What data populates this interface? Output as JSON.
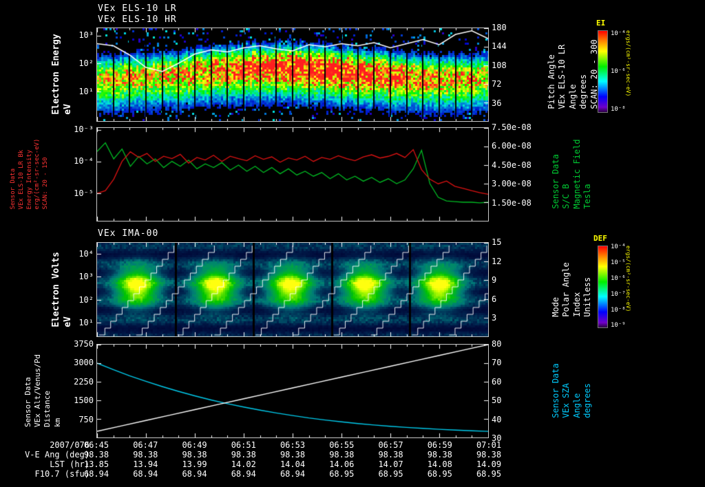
{
  "page": {
    "background": "#000000",
    "accent_yellow": "#ffff00",
    "accent_red": "#ff3333",
    "accent_green": "#00cc33",
    "accent_cyan": "#00ccff"
  },
  "panels": {
    "p1": {
      "titles": [
        "VEx ELS-10 LR",
        "VEx ELS-10 HR"
      ],
      "left_label": [
        "Electron Energy",
        "eV"
      ],
      "right_label": [
        "Pitch Angle",
        "VEx ELS-10 LR",
        "Angle",
        "degrees",
        "SCAN: 20 - 300"
      ]
    },
    "p2": {
      "left_label": [
        "Sensor Data",
        "VEx ELS-10 LR Bk",
        "Energy Intensity",
        "erg/(cm²-sr-sec-eV)",
        "SCAN: 20 - 150"
      ],
      "right_label": [
        "Sensor Data",
        "S/C B",
        "Magnetic Field",
        "Tesla"
      ]
    },
    "p3": {
      "title": "VEx IMA-00",
      "left_label": [
        "Electron Volts",
        "eV"
      ],
      "right_label": [
        "Mode",
        "Polar Angle",
        "Index",
        "Unitless"
      ]
    },
    "p4": {
      "left_label": [
        "Sensor Data",
        "VEx Alt/Venus/Pd",
        "Distance",
        "km"
      ],
      "right_label": [
        "Sensor Data",
        "VEx SZA",
        "Angle",
        "degrees"
      ]
    }
  },
  "chart_data": [
    {
      "id": "els-energy-spectrogram",
      "type": "heatmap",
      "title": "VEx ELS-10 LR / VEx ELS-10 HR",
      "ylabel": "Electron Energy eV",
      "y_scale": "log",
      "y_tick_labels": [
        "10³",
        "10²",
        "10¹"
      ],
      "x_range": [
        "06:45",
        "07:01"
      ],
      "colormap": "rainbow",
      "right_axis": {
        "label": "Pitch Angle VEx ELS-10 LR Angle degrees SCAN: 20 - 300",
        "ticks": [
          "180",
          "144",
          "108",
          "72",
          "36"
        ],
        "range": [
          0,
          180
        ]
      },
      "colorbar": {
        "title": "EI",
        "units": "ergs/(cm²-sr-sec-eV)",
        "tick_labels": [
          "10⁻⁴",
          "10⁻⁶",
          "10⁻⁸"
        ]
      },
      "pattern": {
        "band_center_frac": 0.46,
        "n_scans": 24,
        "description": "intense electron flux band near 100 eV, red core with green halo, blue speckle background, black scan boundaries"
      },
      "overlay_pitch_angle_deg": [
        150,
        146,
        128,
        104,
        96,
        112,
        130,
        138,
        134,
        142,
        146,
        140,
        136,
        148,
        144,
        150,
        146,
        152,
        142,
        150,
        158,
        148,
        168,
        175,
        160
      ]
    },
    {
      "id": "els-bk-intensity-and-b-field",
      "type": "line",
      "left_axis": {
        "scale": "log",
        "tick_labels": [
          "10⁻³",
          "10⁻⁴",
          "10⁻⁵"
        ],
        "range_log10": [
          -3,
          -5.9
        ]
      },
      "right_axis": {
        "tick_labels": [
          "7.50e-08",
          "6.00e-08",
          "4.50e-08",
          "3.00e-08",
          "1.50e-08"
        ],
        "range": [
          0,
          7.5e-08
        ]
      },
      "series": [
        {
          "name": "VEx ELS-10 LR Bk Energy Intensity",
          "units": "erg/(cm²-sr-sec-eV)",
          "axis": "left",
          "color": "#dd1111",
          "y": [
            9e-06,
            1.1e-05,
            2.5e-05,
            9e-05,
            0.00018,
            0.00012,
            0.00016,
            9e-05,
            0.00013,
            0.00011,
            0.00015,
            8e-05,
            0.00012,
            0.0001,
            0.00014,
            9e-05,
            0.00013,
            0.00011,
            9.5e-05,
            0.000135,
            0.000105,
            0.000125,
            8.5e-05,
            0.000115,
            0.0001,
            0.00013,
            9e-05,
            0.00012,
            0.000105,
            0.000135,
            0.00011,
            9.5e-05,
            0.000125,
            0.000145,
            0.000115,
            0.00013,
            0.00016,
            0.00012,
            0.00021,
            5e-05,
            2.5e-05,
            1.8e-05,
            2.2e-05,
            1.5e-05,
            1.3e-05,
            1.1e-05,
            9.5e-06,
            8.5e-06
          ]
        },
        {
          "name": "S/C B Magnetic Field",
          "units": "Tesla",
          "axis": "right",
          "color": "#00bb22",
          "y": [
            5.6e-08,
            6.3e-08,
            5e-08,
            5.8e-08,
            4.4e-08,
            5.2e-08,
            4.6e-08,
            5e-08,
            4.3e-08,
            4.8e-08,
            4.4e-08,
            4.9e-08,
            4.2e-08,
            4.6e-08,
            4.3e-08,
            4.7e-08,
            4.1e-08,
            4.5e-08,
            4e-08,
            4.4e-08,
            3.9e-08,
            4.3e-08,
            3.8e-08,
            4.2e-08,
            3.7e-08,
            4e-08,
            3.6e-08,
            3.9e-08,
            3.4e-08,
            3.8e-08,
            3.3e-08,
            3.6e-08,
            3.2e-08,
            3.5e-08,
            3.1e-08,
            3.4e-08,
            3e-08,
            3.3e-08,
            4.2e-08,
            5.7e-08,
            3e-08,
            1.9e-08,
            1.6e-08,
            1.55e-08,
            1.5e-08,
            1.5e-08,
            1.45e-08,
            1.5e-08
          ]
        }
      ]
    },
    {
      "id": "ima-spectrogram",
      "type": "heatmap",
      "title": "VEx IMA-00",
      "ylabel": "Electron Volts eV",
      "y_scale": "log",
      "y_tick_labels": [
        "10⁴",
        "10³",
        "10²",
        "10¹"
      ],
      "colormap": "blue-green-yellow",
      "right_axis": {
        "label": "Mode Polar Angle Index Unitless",
        "ticks": [
          "15",
          "12",
          "9",
          "6",
          "3"
        ],
        "range": [
          0,
          15
        ]
      },
      "colorbar": {
        "title": "DEF",
        "units": "ergs/(cm²-sr-sec-eV)",
        "tick_labels": [
          "10⁻⁴",
          "10⁻⁵",
          "10⁻⁶",
          "10⁻⁷",
          "10⁻⁸",
          "10⁻⁹"
        ]
      },
      "pattern": {
        "n_cycles": 5,
        "blob_centers_frac": [
          0.1,
          0.3,
          0.49,
          0.68,
          0.87
        ],
        "blob_y_frac": 0.45,
        "description": "periodic ion energy sweeps: bright green-yellow blobs at mid energy on blue background, white stepped elevation-scan diagonals"
      }
    },
    {
      "id": "altitude-and-sza",
      "type": "line",
      "left_axis": {
        "ticks": [
          "3750",
          "3000",
          "2250",
          "1500",
          "750"
        ],
        "range": [
          0,
          3750
        ]
      },
      "right_axis": {
        "ticks": [
          "80",
          "70",
          "60",
          "50",
          "40",
          "30"
        ],
        "range": [
          30,
          80
        ]
      },
      "series": [
        {
          "name": "VEx Alt/Venus/Pd Distance",
          "units": "km",
          "axis": "left",
          "color": "#ffffff",
          "y": [
            250,
            469,
            688,
            906,
            1125,
            1344,
            1563,
            1781,
            2000,
            2219,
            2438,
            2656,
            2875,
            3094,
            3313,
            3531,
            3750
          ]
        },
        {
          "name": "VEx SZA Angle",
          "units": "degrees",
          "axis": "right",
          "color": "#00ccee",
          "y": [
            70,
            66.5,
            63.2,
            60.2,
            57.4,
            54.8,
            52.4,
            50.2,
            48.2,
            46.4,
            44.7,
            43.2,
            41.8,
            40.5,
            39.4,
            38.4,
            37.5,
            36.7,
            36.0,
            35.4,
            34.9,
            34.4,
            34.0,
            33.6,
            33.3
          ]
        }
      ]
    }
  ],
  "footer": {
    "date": "2007/076",
    "time_ticks": [
      "06:45",
      "06:47",
      "06:49",
      "06:51",
      "06:53",
      "06:55",
      "06:57",
      "06:59",
      "07:01"
    ],
    "rows": [
      {
        "label": "V-E Ang (deg)",
        "values": [
          "98.38",
          "98.38",
          "98.38",
          "98.38",
          "98.38",
          "98.38",
          "98.38",
          "98.38",
          "98.38"
        ]
      },
      {
        "label": "LST (hr)",
        "values": [
          "13.85",
          "13.94",
          "13.99",
          "14.02",
          "14.04",
          "14.06",
          "14.07",
          "14.08",
          "14.09"
        ]
      },
      {
        "label": "F10.7 (sfu)",
        "values": [
          "68.94",
          "68.94",
          "68.94",
          "68.94",
          "68.94",
          "68.95",
          "68.95",
          "68.95",
          "68.95"
        ]
      }
    ]
  }
}
